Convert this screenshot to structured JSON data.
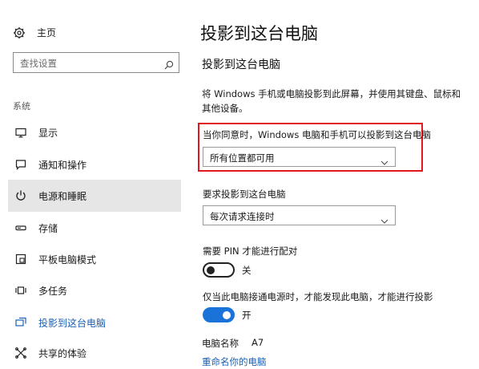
{
  "sidebar": {
    "home_label": "主页",
    "search_placeholder": "查找设置",
    "section_label": "系统",
    "items": [
      {
        "label": "显示",
        "icon": "monitor-icon"
      },
      {
        "label": "通知和操作",
        "icon": "notification-icon"
      },
      {
        "label": "电源和睡眠",
        "icon": "power-icon"
      },
      {
        "label": "存储",
        "icon": "storage-icon"
      },
      {
        "label": "平板电脑模式",
        "icon": "tablet-mode-icon"
      },
      {
        "label": "多任务",
        "icon": "multitask-icon"
      },
      {
        "label": "投影到这台电脑",
        "icon": "project-icon"
      },
      {
        "label": "共享的体验",
        "icon": "shared-experience-icon"
      }
    ]
  },
  "main": {
    "page_title": "投影到这台电脑",
    "section_title": "投影到这台电脑",
    "description": "将 Windows 手机或电脑投影到此屏幕，并使用其键盘、鼠标和其他设备。",
    "availability_label": "当你同意时，Windows 电脑和手机可以投影到这台电脑",
    "availability_value": "所有位置都可用",
    "request_label": "要求投影到这台电脑",
    "request_value": "每次请求连接时",
    "pin_label": "需要 PIN 才能进行配对",
    "pin_state": "关",
    "power_label": "仅当此电脑接通电源时，才能发现此电脑，才能进行投影",
    "power_state": "开",
    "pc_name_label": "电脑名称",
    "pc_name_value": "A7",
    "rename_link": "重命名你的电脑"
  },
  "colors": {
    "accent": "#1a73d9",
    "link": "#1a5fb4",
    "highlight_border": "#e0191f",
    "active_bg": "#e6e6e6"
  }
}
